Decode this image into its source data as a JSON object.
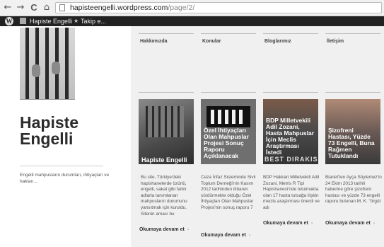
{
  "browser": {
    "back_icon": "←",
    "forward_icon": "→",
    "reload_icon": "C",
    "home_icon": "⌂",
    "url_host": "hapisteengelli.wordpress.com",
    "url_path": "/page/2/"
  },
  "admin_bar": {
    "wp_logo": "W",
    "site_name": "Hapiste Engelli",
    "follow_icon": "★",
    "follow_label": "Takip e..."
  },
  "site": {
    "title": "Hapiste Engelli",
    "description": "Engelli mahpusların durumları, ihtiyaçları ve hakları..."
  },
  "nav": [
    "Hakkımızda",
    "Konular",
    "Bloglarımız",
    "İletişim"
  ],
  "posts": [
    {
      "caption": "Hapiste Engelli",
      "excerpt": "Bu site, Türkiye'deki hapishanelerde özürlü, engelli, sakat gibi farklı adlarla tanımlanan mahpusların durumunu yansıtmak için kuruldu. Sitenin amacı bu",
      "read_more": "Okumaya devam et",
      "arrow": "›"
    },
    {
      "caption": "Özel İhtiyaçları Olan Mahpuslar Projesi Sonuç Raporu Açıklanacak",
      "excerpt": "Ceza İnfaz Sisteminde Sivil Toplum Derneği'nin Kasım 2012 tarihinden itibaren sürdürmekte olduğu Özel İhtiyaçları Olan Mahpuslar Projesi'nin sonuç raporu 7",
      "read_more": "Okumaya devam et",
      "arrow": "›"
    },
    {
      "caption": "BDP Milletvekili Adil Zozani, Hasta Mahpuslar İçin Meclis Araştırması İstedi",
      "image_text": "BEST DIRAKIS",
      "excerpt": "BDP Hakkari Milletvekili Adil Zozani, Metris R Tipi Hapishanesi'nde tutulmakta olan 17 hasta tutsağa ilişkin meclis araştırması önerdi ve adı",
      "read_more": "Okumaya devam et",
      "arrow": "›"
    },
    {
      "caption": "Şizofreni Hastası, Yüzde 73 Engelli, Buna Rağmen Tutuklandı",
      "excerpt": "Bianet'ten Ayça Söylemez'in 24 Ekim 2013 tarihli haberine göre şizofreni hastası ve yüzde 73 engelli raporu bulunan M. K. \"örgüt",
      "read_more": "Okumaya devam et",
      "arrow": "›"
    }
  ]
}
